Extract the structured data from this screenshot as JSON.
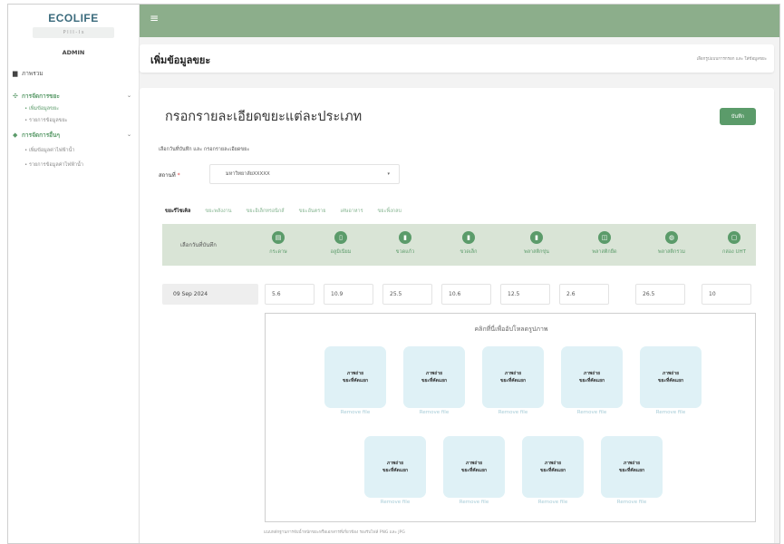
{
  "app": {
    "logo": "ECOLIFE",
    "logo_sub": "P I I I - I s",
    "user_role": "ADMIN"
  },
  "sidebar": {
    "items": [
      {
        "label": "ภาพรวม",
        "icon": "document-icon"
      },
      {
        "label": "การจัดการขยะ",
        "icon": "users-icon",
        "sub": [
          {
            "label": "• เพิ่มข้อมูลขยะ",
            "active": true
          },
          {
            "label": "• รายการข้อมูลขยะ",
            "active": false
          }
        ]
      },
      {
        "label": "การจัดการอื่นๆ",
        "icon": "tag-icon",
        "sub": [
          {
            "label": "• เพิ่มข้อมูลค่าไฟฟ้าน้ำ",
            "active": false
          },
          {
            "label": "• รายการข้อมูลค่าไฟฟ้าน้ำ",
            "active": false
          }
        ]
      }
    ]
  },
  "header": {
    "title": "เพิ่มข้อมูลขยะ",
    "hint": "เลือกรูปแบบการกรอก และ ใส่ข้อมูลขยะ"
  },
  "form": {
    "title": "กรอกรายละเอียดขยะแต่ละประเภท",
    "save_label": "บันทึก",
    "hint": "เลือกวันที่บันทึก และ กรอกรายละเอียดขยะ",
    "station_label": "สถานที่",
    "station_required": "*",
    "station_value": "มหาวิทยาลัยXXXXX",
    "tabs": [
      "ขยะรีไซเคิล",
      "ขยะพลังงาน",
      "ขยะอิเล็กทรอนิกส์",
      "ขยะอันตราย",
      "เศษอาหาร",
      "ขยะพิ้งกลบ"
    ],
    "date_header": "เลือกวันที่บันทึก",
    "categories": [
      {
        "name": "กระดาษ",
        "icon": "paper-icon"
      },
      {
        "name": "อลูมิเนียม",
        "icon": "can-icon"
      },
      {
        "name": "ขวดแก้ว",
        "icon": "glass-bottle-icon"
      },
      {
        "name": "ขวดเล็ก",
        "icon": "small-bottle-icon"
      },
      {
        "name": "พลาสติกขุ่น",
        "icon": "plastic-opaque-icon"
      },
      {
        "name": "พลาสติกยืด",
        "icon": "plastic-stretch-icon"
      },
      {
        "name": "พลาสติกรวม",
        "icon": "plastic-mixed-icon"
      },
      {
        "name": "กล่อง UHT",
        "icon": "uht-box-icon"
      }
    ],
    "entry": {
      "date": "09 Sep 2024",
      "values": [
        "5.6",
        "10.9",
        "25.5",
        "10.6",
        "12.5",
        "2.6",
        "26.5",
        "10"
      ]
    },
    "upload": {
      "title": "คลิกที่นี่เพื่ออัปโหลดรูปภาพ",
      "file_label_line1": "ภาพถ่าย",
      "file_label_line2": "ขยะที่คัดแยก",
      "remove_label": "Remove file",
      "file_count": 9
    },
    "footnote": "แนบหลักฐานการจับน้ำหนักขยะหรือเอกสารที่เกี่ยวข้อง รองรับไฟล์ PNG และ JPG"
  }
}
